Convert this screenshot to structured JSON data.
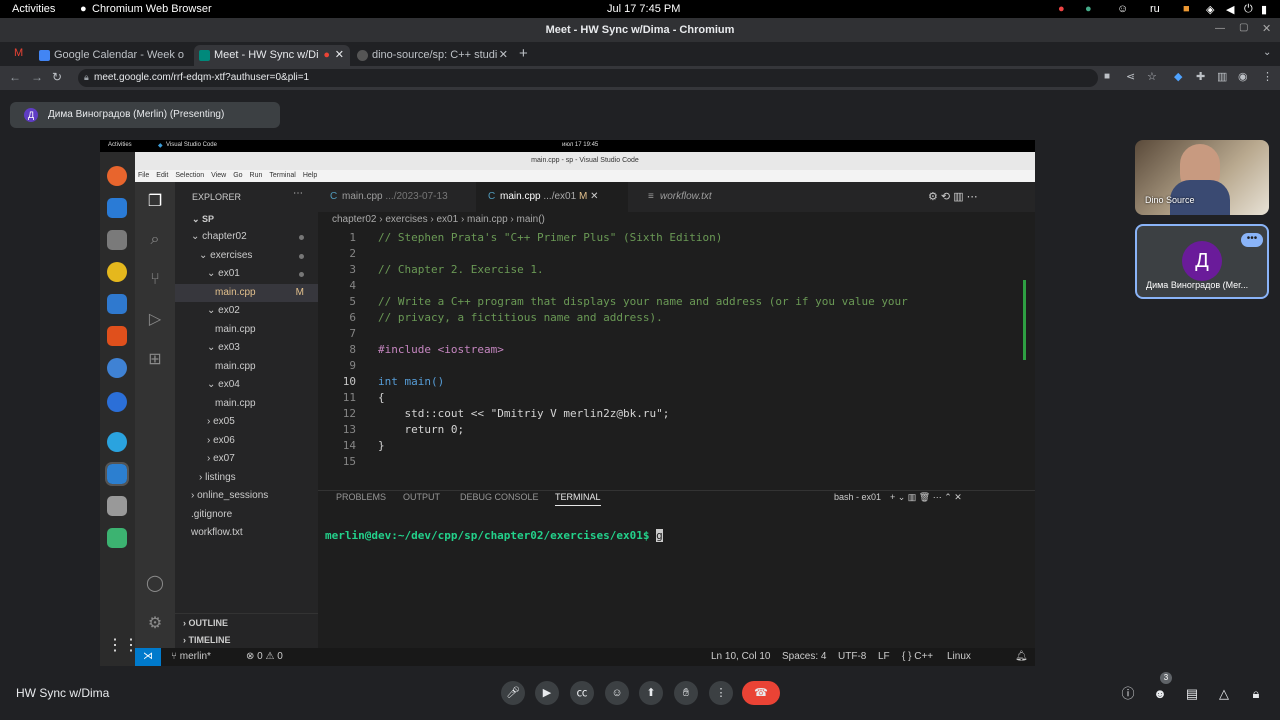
{
  "gnome": {
    "activities": "Activities",
    "app": "Chromium Web Browser",
    "clock": "Jul 17  7:45 PM",
    "lang": "ru"
  },
  "chrome": {
    "window_title": "Meet - HW Sync w/Dima - Chromium",
    "tabs": [
      {
        "label": "Google Calendar - Week o"
      },
      {
        "label": "Meet - HW Sync w/Di"
      },
      {
        "label": "dino-source/sp: C++ studi"
      }
    ],
    "url": "meet.google.com/rrf-edqm-xtf?authuser=0&pli=1"
  },
  "meet": {
    "presenting": "Дима Виноградов (Merlin) (Presenting)",
    "avatar_letter": "Д",
    "meeting_name": "HW Sync w/Dima",
    "people_count": "3",
    "participants": [
      {
        "name": "Dino Source"
      },
      {
        "name": "Дима Виноградов (Mer..."
      }
    ]
  },
  "shared": {
    "ubuntu_activities": "Activities",
    "ubuntu_app": "Visual Studio Code",
    "ubuntu_clock": "июл 17  19:45",
    "vscode_title": "main.cpp - sp - Visual Studio Code",
    "menu": [
      "File",
      "Edit",
      "Selection",
      "View",
      "Go",
      "Run",
      "Terminal",
      "Help"
    ],
    "explorer": {
      "header": "EXPLORER",
      "root": "SP",
      "items": [
        {
          "label": "chapter02",
          "dot": true
        },
        {
          "label": "exercises",
          "dot": true
        },
        {
          "label": "ex01",
          "dot": true
        },
        {
          "label": "main.cpp",
          "badge": "M"
        },
        {
          "label": "ex02"
        },
        {
          "label": "main.cpp"
        },
        {
          "label": "ex03"
        },
        {
          "label": "main.cpp"
        },
        {
          "label": "ex04"
        },
        {
          "label": "main.cpp"
        },
        {
          "label": "ex05"
        },
        {
          "label": "ex06"
        },
        {
          "label": "ex07"
        },
        {
          "label": "listings"
        },
        {
          "label": "online_sessions"
        },
        {
          "label": ".gitignore"
        },
        {
          "label": "workflow.txt"
        }
      ],
      "outline": "OUTLINE",
      "timeline": "TIMELINE"
    },
    "editor_tabs": [
      {
        "label": "main.cpp",
        "desc": ".../2023-07-13"
      },
      {
        "label": "main.cpp",
        "desc": ".../ex01",
        "badge": "M"
      },
      {
        "label": "workflow.txt"
      }
    ],
    "breadcrumb": "chapter02 › exercises › ex01 › main.cpp › main()",
    "code": [
      {
        "n": "1",
        "t": "// Stephen Prata's \"C++ Primer Plus\" (Sixth Edition)",
        "c": "cm"
      },
      {
        "n": "2",
        "t": "",
        "c": "tx"
      },
      {
        "n": "3",
        "t": "// Chapter 2. Exercise 1.",
        "c": "cm"
      },
      {
        "n": "4",
        "t": "",
        "c": "tx"
      },
      {
        "n": "5",
        "t": "// Write a C++ program that displays your name and address (or if you value your",
        "c": "cm"
      },
      {
        "n": "6",
        "t": "// privacy, a fictitious name and address).",
        "c": "cm"
      },
      {
        "n": "7",
        "t": "",
        "c": "tx"
      },
      {
        "n": "8",
        "t": "#include <iostream>",
        "c": "pp"
      },
      {
        "n": "9",
        "t": "",
        "c": "tx"
      },
      {
        "n": "10",
        "t": "int main()",
        "c": "kw"
      },
      {
        "n": "11",
        "t": "{",
        "c": "tx"
      },
      {
        "n": "12",
        "t": "    std::cout << \"Dmitriy V merlin2z@bk.ru\";",
        "c": "tx"
      },
      {
        "n": "13",
        "t": "    return 0;",
        "c": "tx"
      },
      {
        "n": "14",
        "t": "}",
        "c": "tx"
      },
      {
        "n": "15",
        "t": "",
        "c": "tx"
      }
    ],
    "panel_tabs": [
      "PROBLEMS",
      "OUTPUT",
      "DEBUG CONSOLE",
      "TERMINAL"
    ],
    "terminal_name": "bash - ex01",
    "terminal_prompt": "merlin@dev:~/dev/cpp/sp/chapter02/exercises/ex01$ ",
    "terminal_input": "g",
    "status": {
      "branch": "merlin*",
      "problems": "⊗ 0 ⚠ 0",
      "position": "Ln 10, Col 10",
      "spaces": "Spaces: 4",
      "encoding": "UTF-8",
      "eol": "LF",
      "language": "{ } C++",
      "os": "Linux"
    }
  },
  "colors": {
    "accent": "#007acc",
    "end_call": "#ea4335",
    "meet_bg": "#202124"
  }
}
